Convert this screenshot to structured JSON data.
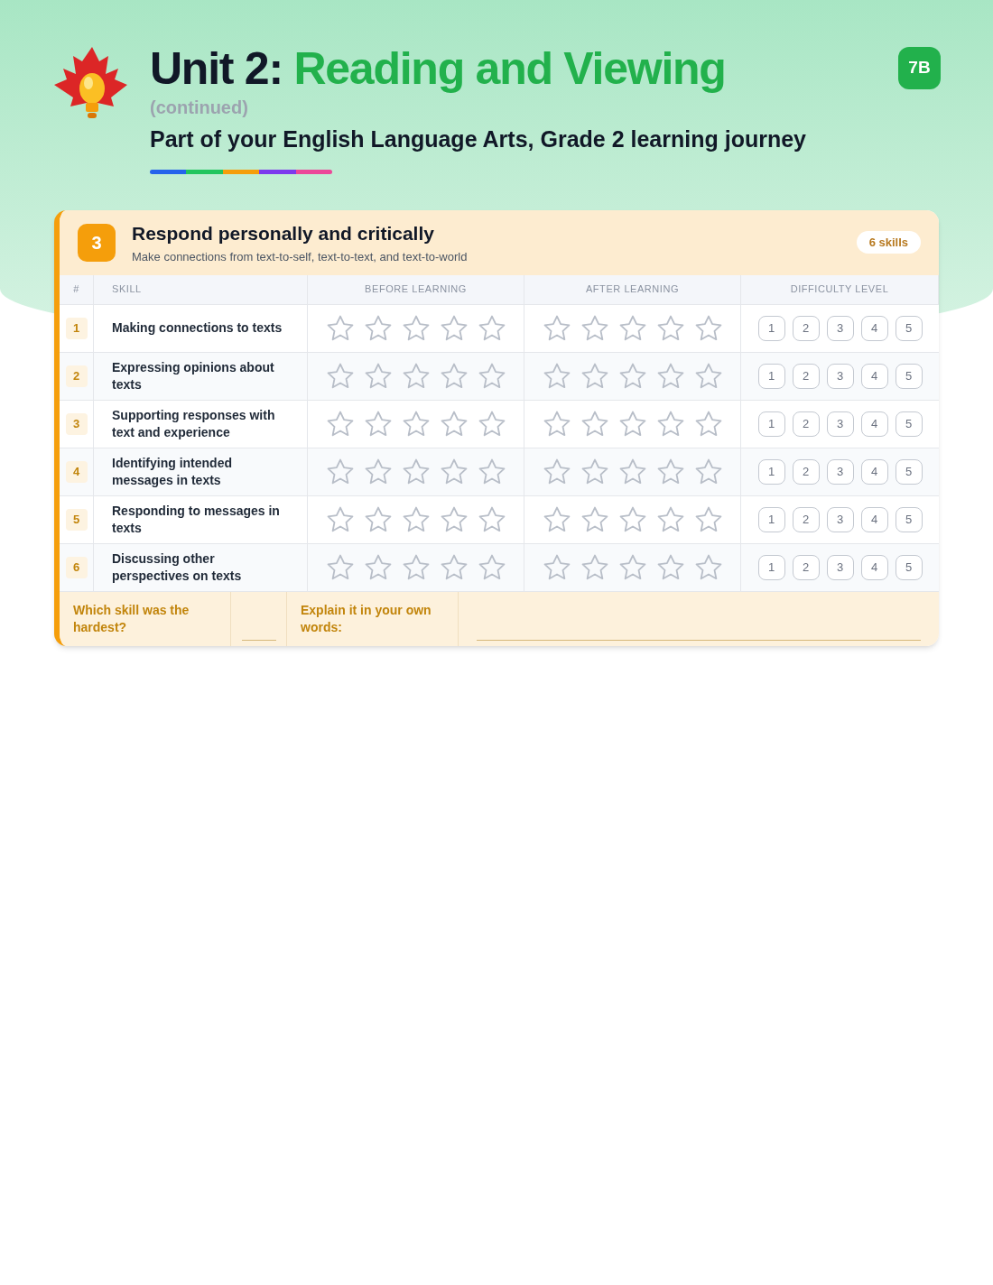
{
  "header": {
    "title_prefix": "Unit 2:",
    "title_main": "Reading and Viewing",
    "continued": "(continued)",
    "subtitle": "Part of your English Language Arts, Grade 2 learning journey",
    "badge": "7B"
  },
  "section": {
    "number": "3",
    "title": "Respond personally and critically",
    "description": "Make connections from text-to-self, text-to-text, and text-to-world",
    "count": "6 skills",
    "columns": [
      "#",
      "SKILL",
      "BEFORE LEARNING",
      "AFTER LEARNING",
      "DIFFICULTY LEVEL"
    ],
    "rows": [
      {
        "number": "1",
        "skill": "Making connections to texts",
        "before": {
          "stars": 0
        },
        "after": {
          "stars": 0
        },
        "levels": [
          "1",
          "2",
          "3",
          "4",
          "5"
        ]
      },
      {
        "number": "2",
        "skill": "Expressing opinions about texts",
        "before": {
          "stars": 0
        },
        "after": {
          "stars": 0
        },
        "levels": [
          "1",
          "2",
          "3",
          "4",
          "5"
        ]
      },
      {
        "number": "3",
        "skill": "Supporting responses with text and experience",
        "before": {
          "stars": 0
        },
        "after": {
          "stars": 0
        },
        "levels": [
          "1",
          "2",
          "3",
          "4",
          "5"
        ]
      },
      {
        "number": "4",
        "skill": "Identifying intended messages in texts",
        "before": {
          "stars": 0
        },
        "after": {
          "stars": 0
        },
        "levels": [
          "1",
          "2",
          "3",
          "4",
          "5"
        ]
      },
      {
        "number": "5",
        "skill": "Responding to messages in texts",
        "before": {
          "stars": 0
        },
        "after": {
          "stars": 0
        },
        "levels": [
          "1",
          "2",
          "3",
          "4",
          "5"
        ]
      },
      {
        "number": "6",
        "skill": "Discussing other perspectives on texts",
        "before": {
          "stars": 0
        },
        "after": {
          "stars": 0
        },
        "levels": [
          "1",
          "2",
          "3",
          "4",
          "5"
        ]
      }
    ],
    "footer": {
      "question": "Which skill was the hardest?",
      "prompt": "Explain it in your own words:"
    }
  }
}
